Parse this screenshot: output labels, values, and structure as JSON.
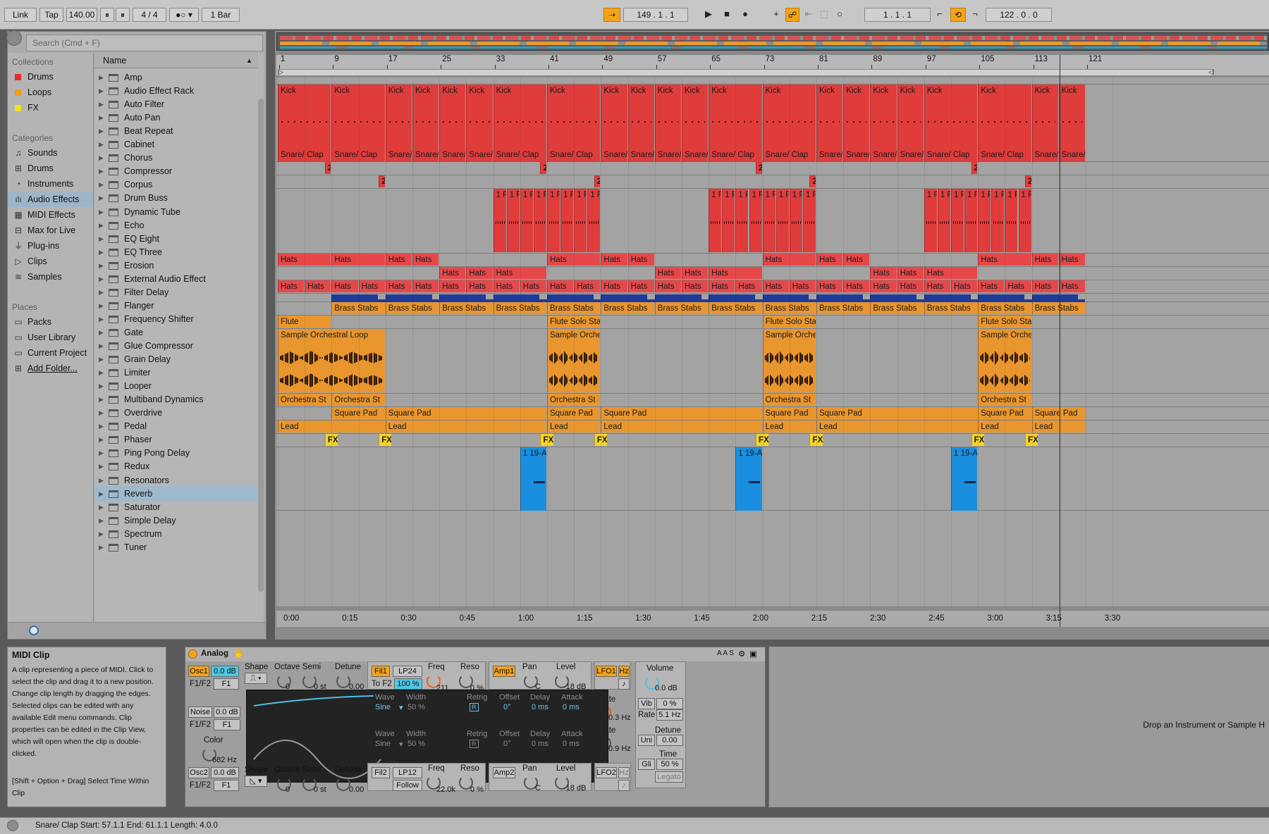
{
  "transport": {
    "link": "Link",
    "tap": "Tap",
    "tempo": "140.00",
    "signature": "4  /  4",
    "quantize": "1 Bar",
    "position": "149 .   1 .   1",
    "loop_start": "1 .   1 .   1",
    "loop_length": "122 .   0 .   0"
  },
  "browser": {
    "search_placeholder": "Search (Cmd + F)",
    "collections_title": "Collections",
    "collections": [
      {
        "label": "Drums",
        "color": "#e82a2a"
      },
      {
        "label": "Loops",
        "color": "#f39a1a"
      },
      {
        "label": "FX",
        "color": "#f2e11e"
      }
    ],
    "categories_title": "Categories",
    "categories": [
      {
        "label": "Sounds",
        "icon": "sounds-icon"
      },
      {
        "label": "Drums",
        "icon": "drums-icon"
      },
      {
        "label": "Instruments",
        "icon": "instruments-icon"
      },
      {
        "label": "Audio Effects",
        "icon": "audio-effects-icon",
        "selected": true
      },
      {
        "label": "MIDI Effects",
        "icon": "midi-effects-icon"
      },
      {
        "label": "Max for Live",
        "icon": "max-for-live-icon"
      },
      {
        "label": "Plug-ins",
        "icon": "plugins-icon"
      },
      {
        "label": "Clips",
        "icon": "clips-icon"
      },
      {
        "label": "Samples",
        "icon": "samples-icon"
      }
    ],
    "places_title": "Places",
    "places": [
      {
        "label": "Packs",
        "icon": "packs-icon"
      },
      {
        "label": "User Library",
        "icon": "user-library-icon"
      },
      {
        "label": "Current Project",
        "icon": "current-project-icon"
      },
      {
        "label": "Add Folder...",
        "icon": "add-folder-icon"
      }
    ],
    "name_header": "Name",
    "items": [
      "Amp",
      "Audio Effect Rack",
      "Auto Filter",
      "Auto Pan",
      "Beat Repeat",
      "Cabinet",
      "Chorus",
      "Compressor",
      "Corpus",
      "Drum Buss",
      "Dynamic Tube",
      "Echo",
      "EQ Eight",
      "EQ Three",
      "Erosion",
      "External Audio Effect",
      "Filter Delay",
      "Flanger",
      "Frequency Shifter",
      "Gate",
      "Glue Compressor",
      "Grain Delay",
      "Limiter",
      "Looper",
      "Multiband Dynamics",
      "Overdrive",
      "Pedal",
      "Phaser",
      "Ping Pong Delay",
      "Redux",
      "Resonators",
      "Reverb",
      "Saturator",
      "Simple Delay",
      "Spectrum",
      "Tuner"
    ],
    "selected_item": "Reverb"
  },
  "ruler": {
    "bars": [
      "1",
      "9",
      "17",
      "25",
      "33",
      "41",
      "49",
      "57",
      "65",
      "73",
      "81",
      "89",
      "97",
      "105",
      "113",
      "121"
    ],
    "times": [
      "0:00",
      "0:15",
      "0:30",
      "0:45",
      "1:00",
      "1:15",
      "1:30",
      "1:45",
      "2:00",
      "2:15",
      "2:30",
      "2:45",
      "3:00",
      "3:15",
      "3:30"
    ]
  },
  "clips": {
    "kick": "Kick",
    "snare": "Snare/ Clap",
    "snare_short": "Snare/",
    "two": "2",
    "onebar": "1 R 1 R 1 R 1",
    "hats": "Hats",
    "brass": "Brass Stabs",
    "flute": "Flute",
    "flute_solo": "Flute Solo Stac",
    "sample_loop": "Sample Orchestral Loop",
    "sample_short": "Sample Orches",
    "orch": "Orchestra St",
    "square": "Square Pad",
    "lead": "Lead",
    "fx": "FX",
    "blue": "1 19-Ar"
  },
  "info": {
    "title": "MIDI Clip",
    "body": "A clip representing a piece of MIDI. Click to select the clip and drag it to a new position. Change clip length by dragging the edges. Selected clips can be edited with any available Edit menu commands. Clip properties can be edited in the Clip View, which will open when the clip is double-clicked.",
    "hint": "[Shift + Option + Drag] Select Time Within Clip"
  },
  "device": {
    "name": "Analog",
    "osc1": "Osc1",
    "osc1_level": "0.0 dB",
    "f1f2": "F1/F2",
    "f1": "F1",
    "shape": "Shape",
    "octave": "Octave",
    "semi": "Semi",
    "detune": "Detune",
    "oct_val": "0",
    "semi_val": "0 st",
    "det_val": "0.00",
    "fil1": "Fil1",
    "lp24": "LP24",
    "to_f2": "To F2",
    "to_f2_val": "100 %",
    "freq": "Freq",
    "freq_val": "211",
    "reso": "Reso",
    "reso_val": "0 %",
    "amp1": "Amp1",
    "pan": "Pan",
    "pan_val": "C",
    "level": "Level",
    "level_val": "-18 dB",
    "lfo1": "LFO1",
    "hz": "Hz",
    "rate": "Rate",
    "rate1": "0.3 Hz",
    "rate2": "0.9 Hz",
    "volume": "Volume",
    "vol_val": "0.0 dB",
    "vib": "Vib",
    "vib_val": "0 %",
    "rate3": "5.1 Hz",
    "uni": "Uni",
    "detune2": "0.00",
    "time": "Time",
    "gli": "Gli",
    "gli_val": "50 %",
    "legato": "Legato",
    "noise": "Noise",
    "noise_level": "0.0 dB",
    "color": "Color",
    "color_val": "682 Hz",
    "wave": "Wave",
    "wave_val": "Sine",
    "width": "Width",
    "width_val": "50 %",
    "retrig": "Retrig",
    "retrig_val": "R",
    "offset": "Offset",
    "offset_val": "0°",
    "delay": "Delay",
    "delay_val": "0 ms",
    "attack": "Attack",
    "attack_val": "0 ms",
    "osc2": "Osc2",
    "osc2_level": "0.0 dB",
    "fil2": "Fil2",
    "lp12": "LP12",
    "follow": "Follow",
    "freq2_val": "22.0k",
    "amp2": "Amp2",
    "lfo2": "LFO2"
  },
  "drop_hint": "Drop an Instrument or Sample H",
  "status": "Snare/ Clap  Start: 57.1.1  End: 61.1.1  Length: 4.0.0"
}
